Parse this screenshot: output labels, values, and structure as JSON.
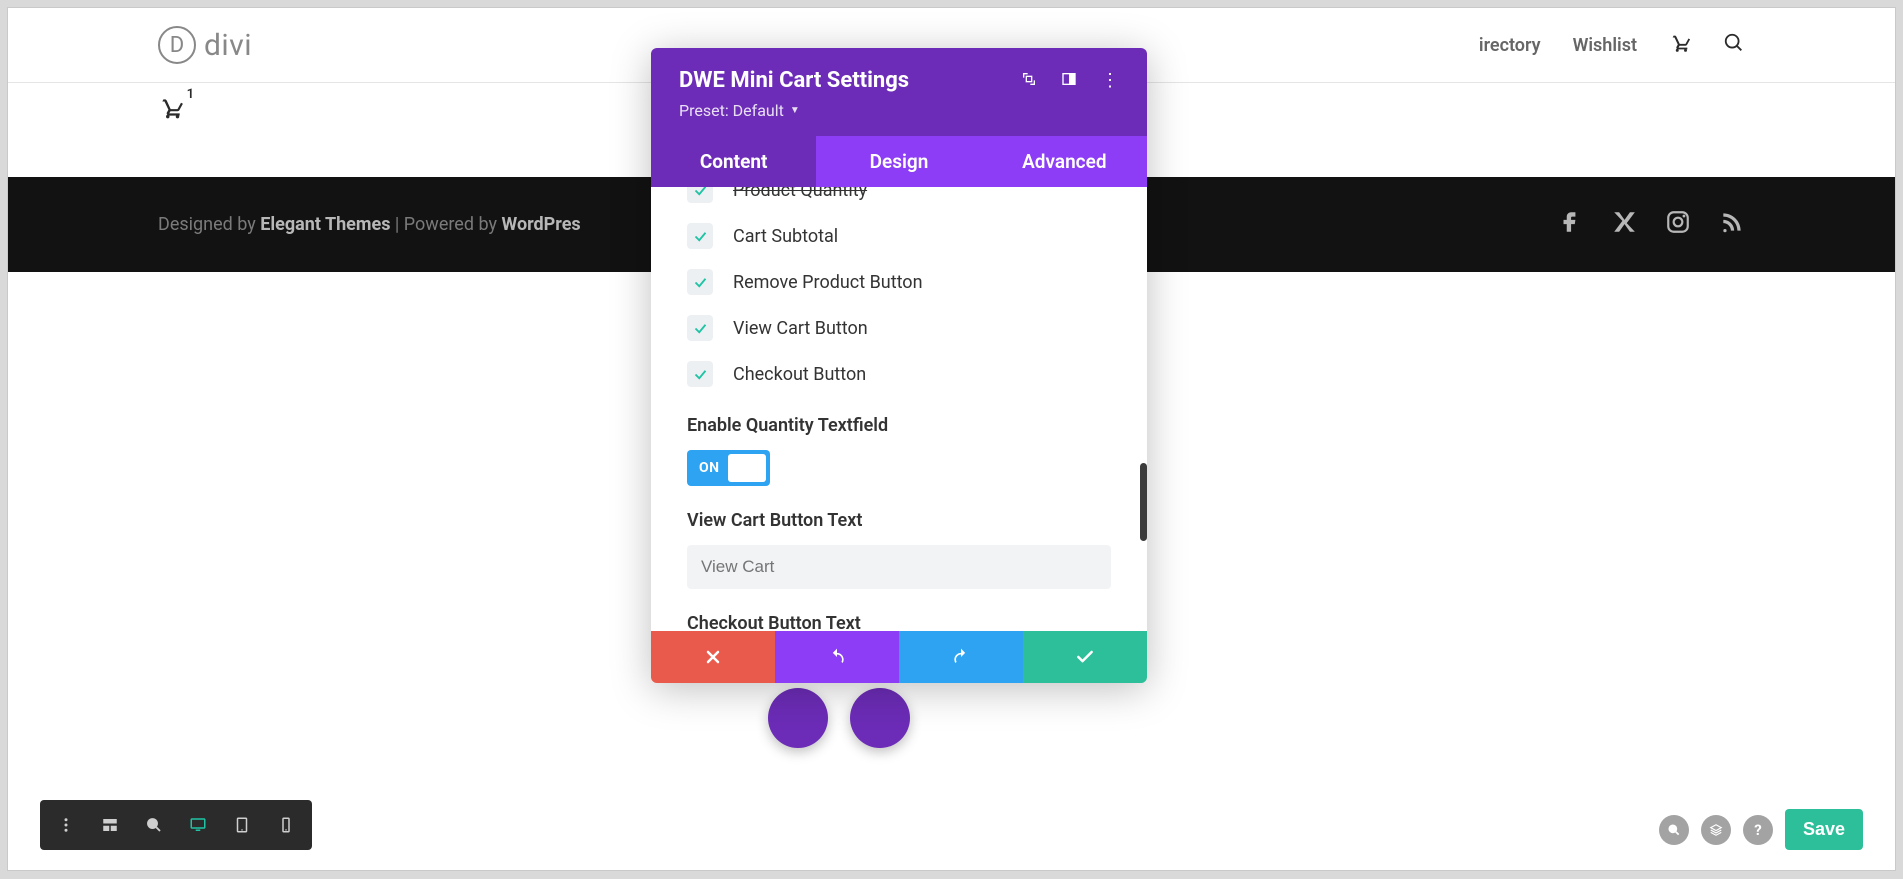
{
  "header": {
    "logo_text": "divi",
    "nav": {
      "directory": "irectory",
      "wishlist": "Wishlist"
    },
    "cart_count": "1"
  },
  "footer": {
    "designed_by": "Designed by ",
    "elegant": "Elegant Themes",
    "sep": " | Powered by ",
    "wp": "WordPres"
  },
  "modal": {
    "title": "DWE Mini Cart Settings",
    "preset": "Preset: Default",
    "tabs": {
      "content": "Content",
      "design": "Design",
      "advanced": "Advanced"
    },
    "checks": {
      "product_quantity": "Product Quantity",
      "cart_subtotal": "Cart Subtotal",
      "remove_product": "Remove Product Button",
      "view_cart": "View Cart Button",
      "checkout": "Checkout Button"
    },
    "enable_qty_label": "Enable Quantity Textfield",
    "toggle_on": "ON",
    "view_cart_label": "View Cart Button Text",
    "view_cart_placeholder": "View Cart",
    "checkout_label": "Checkout Button Text"
  },
  "save": "Save",
  "help": "?"
}
